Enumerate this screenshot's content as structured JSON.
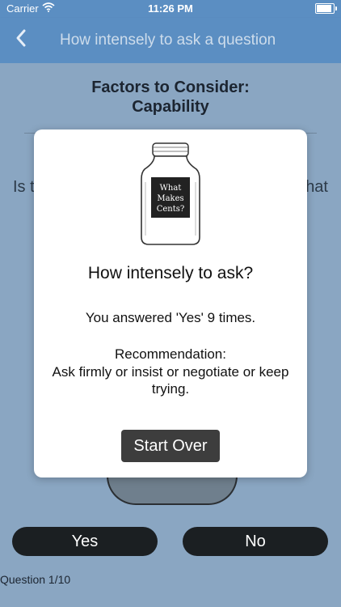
{
  "status_bar": {
    "carrier": "Carrier",
    "time": "11:26 PM"
  },
  "nav": {
    "title": "How intensely to ask a question"
  },
  "screen": {
    "heading_line1": "Factors to Consider:",
    "heading_line2": "Capability",
    "question_left": "Is t",
    "question_right": "hat",
    "yes_label": "Yes",
    "no_label": "No",
    "progress": "Question 1/10"
  },
  "modal": {
    "logo_text": [
      "What",
      "Makes",
      "Cents?"
    ],
    "heading": "How intensely to ask?",
    "answered": "You answered 'Yes' 9 times.",
    "recommendation_label": "Recommendation:",
    "recommendation_text": "Ask firmly or insist or negotiate or keep trying.",
    "start_over_label": "Start Over"
  },
  "colors": {
    "nav_bg": "#5b8ec2",
    "overlay_bg": "#8aa6c2",
    "button_dark": "#1b1f22",
    "start_over_bg": "#3d3d3d"
  }
}
